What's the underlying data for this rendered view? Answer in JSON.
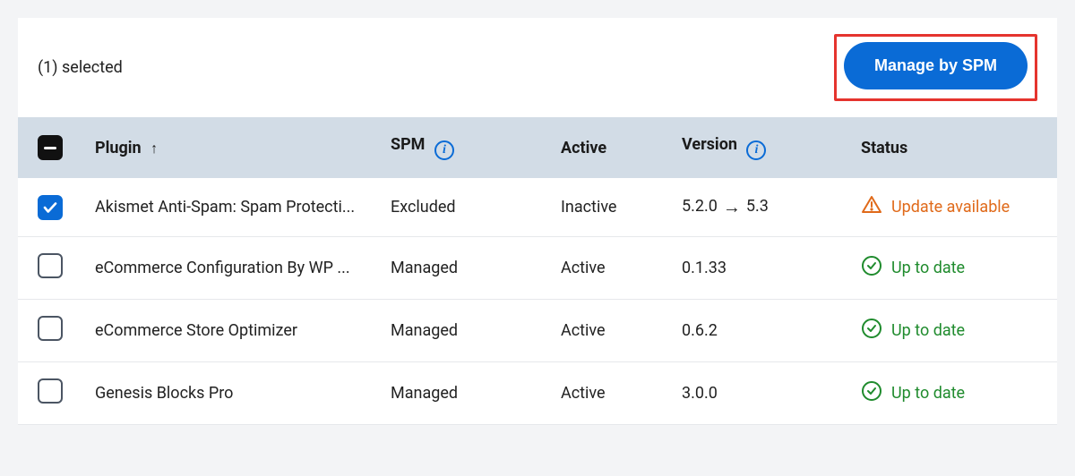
{
  "topbar": {
    "selected_text": "(1) selected",
    "manage_label": "Manage by SPM"
  },
  "columns": {
    "plugin": "Plugin",
    "spm": "SPM",
    "active": "Active",
    "version": "Version",
    "status": "Status"
  },
  "rows": [
    {
      "checked": true,
      "plugin": "Akismet Anti-Spam: Spam Protecti...",
      "spm": "Excluded",
      "active": "Inactive",
      "version_from": "5.2.0",
      "version_to": "5.3",
      "status": "Update available",
      "status_kind": "warn"
    },
    {
      "checked": false,
      "plugin": "eCommerce Configuration By WP ...",
      "spm": "Managed",
      "active": "Active",
      "version_from": "0.1.33",
      "version_to": "",
      "status": "Up to date",
      "status_kind": "ok"
    },
    {
      "checked": false,
      "plugin": "eCommerce Store Optimizer",
      "spm": "Managed",
      "active": "Active",
      "version_from": "0.6.2",
      "version_to": "",
      "status": "Up to date",
      "status_kind": "ok"
    },
    {
      "checked": false,
      "plugin": "Genesis Blocks Pro",
      "spm": "Managed",
      "active": "Active",
      "version_from": "3.0.0",
      "version_to": "",
      "status": "Up to date",
      "status_kind": "ok"
    }
  ],
  "colors": {
    "accent": "#0a6bd6",
    "ok": "#1f8b2d",
    "warn": "#e06a1a",
    "highlight": "#e5342e"
  }
}
